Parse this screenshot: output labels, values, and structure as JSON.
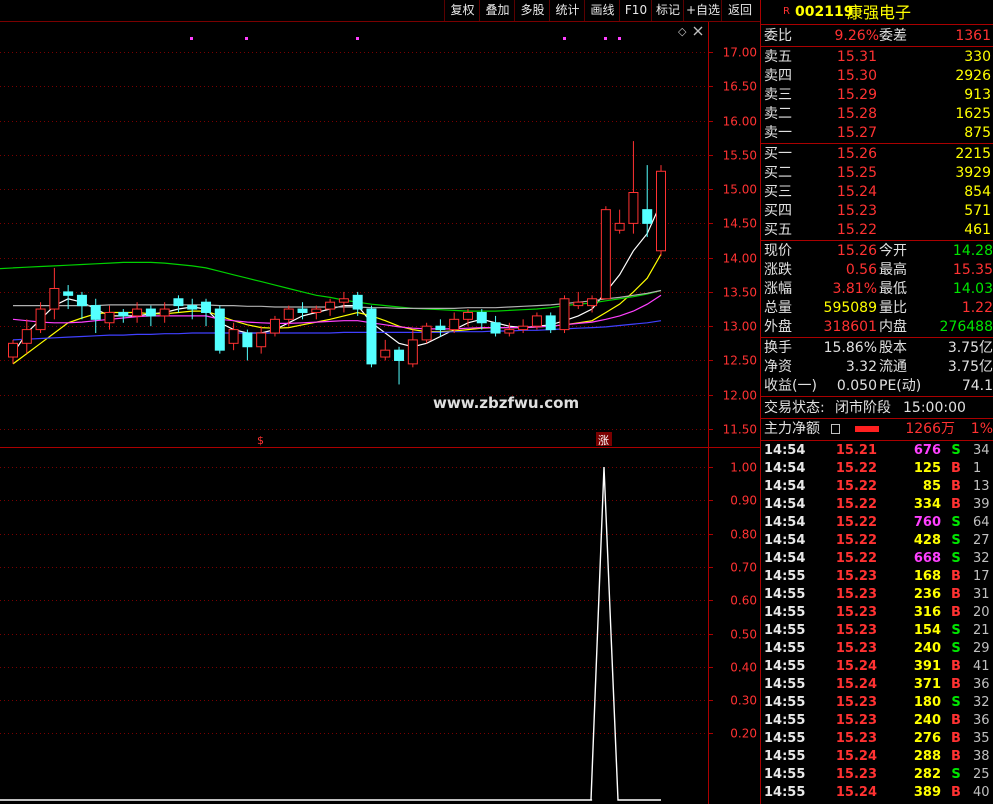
{
  "toolbar": {
    "buttons": [
      "复权",
      "叠加",
      "多股",
      "统计",
      "画线",
      "F10",
      "标记",
      "+自选",
      "返回"
    ]
  },
  "stock": {
    "badge": "R",
    "code": "002119",
    "name": "康强电子"
  },
  "price_axis": [
    "17.00",
    "16.50",
    "16.00",
    "15.50",
    "15.00",
    "14.50",
    "14.00",
    "13.50",
    "13.00",
    "12.50",
    "12.00",
    "11.50"
  ],
  "indicator_axis": [
    "1.00",
    "0.90",
    "0.80",
    "0.70",
    "0.60",
    "0.50",
    "0.40",
    "0.30",
    "0.20"
  ],
  "watermark": "www.zbzfwu.com",
  "markers": {
    "s_label": "$",
    "zhang_label": "涨",
    "diamond": "◇"
  },
  "order_book": {
    "weibi_label": "委比",
    "weibi_value": "9.26%",
    "weicha_label": "委差",
    "weicha_value": "1361",
    "asks": [
      {
        "label": "卖五",
        "price": "15.31",
        "vol": "330"
      },
      {
        "label": "卖四",
        "price": "15.30",
        "vol": "2926"
      },
      {
        "label": "卖三",
        "price": "15.29",
        "vol": "913"
      },
      {
        "label": "卖二",
        "price": "15.28",
        "vol": "1625"
      },
      {
        "label": "卖一",
        "price": "15.27",
        "vol": "875"
      }
    ],
    "bids": [
      {
        "label": "买一",
        "price": "15.26",
        "vol": "2215"
      },
      {
        "label": "买二",
        "price": "15.25",
        "vol": "3929"
      },
      {
        "label": "买三",
        "price": "15.24",
        "vol": "854"
      },
      {
        "label": "买四",
        "price": "15.23",
        "vol": "571"
      },
      {
        "label": "买五",
        "price": "15.22",
        "vol": "461"
      }
    ]
  },
  "quote": [
    {
      "l1": "现价",
      "v1": "15.26",
      "l2": "今开",
      "v2": "14.28",
      "c1": "red",
      "c2": "green"
    },
    {
      "l1": "涨跌",
      "v1": "0.56",
      "l2": "最高",
      "v2": "15.35",
      "c1": "red",
      "c2": "red"
    },
    {
      "l1": "涨幅",
      "v1": "3.81%",
      "l2": "最低",
      "v2": "14.03",
      "c1": "red",
      "c2": "green"
    },
    {
      "l1": "总量",
      "v1": "595089",
      "l2": "量比",
      "v2": "1.22",
      "c1": "yellow",
      "c2": "red"
    },
    {
      "l1": "外盘",
      "v1": "318601",
      "l2": "内盘",
      "v2": "276488",
      "c1": "red",
      "c2": "green"
    }
  ],
  "fundamentals": [
    {
      "l1": "换手",
      "v1": "15.86%",
      "l2": "股本",
      "v2": "3.75亿"
    },
    {
      "l1": "净资",
      "v1": "3.32",
      "l2": "流通",
      "v2": "3.75亿"
    },
    {
      "l1": "收益(一)",
      "v1": "0.050",
      "l2": "PE(动)",
      "v2": "74.1"
    }
  ],
  "trade_status": {
    "label": "交易状态:",
    "value": "闭市阶段",
    "time": "15:00:00"
  },
  "capital_flow": {
    "label": "主力净额",
    "value": "1266万",
    "pct": "1%"
  },
  "ticks": [
    {
      "time": "14:54",
      "price": "15.21",
      "vol": "676",
      "bs": "S",
      "n": "34",
      "vc": "magenta"
    },
    {
      "time": "14:54",
      "price": "15.22",
      "vol": "125",
      "bs": "B",
      "n": "1",
      "vc": "yellow"
    },
    {
      "time": "14:54",
      "price": "15.22",
      "vol": "85",
      "bs": "B",
      "n": "13",
      "vc": "yellow"
    },
    {
      "time": "14:54",
      "price": "15.22",
      "vol": "334",
      "bs": "B",
      "n": "39",
      "vc": "yellow"
    },
    {
      "time": "14:54",
      "price": "15.22",
      "vol": "760",
      "bs": "S",
      "n": "64",
      "vc": "magenta"
    },
    {
      "time": "14:54",
      "price": "15.22",
      "vol": "428",
      "bs": "S",
      "n": "27",
      "vc": "yellow"
    },
    {
      "time": "14:54",
      "price": "15.22",
      "vol": "668",
      "bs": "S",
      "n": "32",
      "vc": "magenta"
    },
    {
      "time": "14:55",
      "price": "15.23",
      "vol": "168",
      "bs": "B",
      "n": "17",
      "vc": "yellow"
    },
    {
      "time": "14:55",
      "price": "15.23",
      "vol": "236",
      "bs": "B",
      "n": "31",
      "vc": "yellow"
    },
    {
      "time": "14:55",
      "price": "15.23",
      "vol": "316",
      "bs": "B",
      "n": "20",
      "vc": "yellow"
    },
    {
      "time": "14:55",
      "price": "15.23",
      "vol": "154",
      "bs": "S",
      "n": "21",
      "vc": "yellow"
    },
    {
      "time": "14:55",
      "price": "15.23",
      "vol": "240",
      "bs": "S",
      "n": "29",
      "vc": "yellow"
    },
    {
      "time": "14:55",
      "price": "15.24",
      "vol": "391",
      "bs": "B",
      "n": "41",
      "vc": "yellow"
    },
    {
      "time": "14:55",
      "price": "15.24",
      "vol": "371",
      "bs": "B",
      "n": "36",
      "vc": "yellow"
    },
    {
      "time": "14:55",
      "price": "15.23",
      "vol": "180",
      "bs": "S",
      "n": "32",
      "vc": "yellow"
    },
    {
      "time": "14:55",
      "price": "15.23",
      "vol": "240",
      "bs": "B",
      "n": "36",
      "vc": "yellow"
    },
    {
      "time": "14:55",
      "price": "15.23",
      "vol": "276",
      "bs": "B",
      "n": "35",
      "vc": "yellow"
    },
    {
      "time": "14:55",
      "price": "15.24",
      "vol": "288",
      "bs": "B",
      "n": "38",
      "vc": "yellow"
    },
    {
      "time": "14:55",
      "price": "15.23",
      "vol": "282",
      "bs": "S",
      "n": "25",
      "vc": "yellow"
    },
    {
      "time": "14:55",
      "price": "15.24",
      "vol": "389",
      "bs": "B",
      "n": "40",
      "vc": "yellow"
    }
  ],
  "colors": {
    "up": "#ff3232",
    "down": "#54ffff",
    "grid": "#7a0000",
    "yellow": "#ffff00",
    "green": "#00e600",
    "magenta": "#ff40ff"
  },
  "chart_data": [
    {
      "type": "candlestick",
      "yaxis": "price",
      "ylim": [
        11.3,
        17.4
      ],
      "candles": [
        [
          12.55,
          12.75,
          12.45,
          12.8
        ],
        [
          12.75,
          12.95,
          12.6,
          13.1
        ],
        [
          12.95,
          13.25,
          12.9,
          13.35
        ],
        [
          13.25,
          13.55,
          13.1,
          13.85
        ],
        [
          13.5,
          13.45,
          13.25,
          13.6
        ],
        [
          13.45,
          13.3,
          13.1,
          13.5
        ],
        [
          13.3,
          13.1,
          12.9,
          13.4
        ],
        [
          13.05,
          13.2,
          12.95,
          13.3
        ],
        [
          13.2,
          13.15,
          13.05,
          13.25
        ],
        [
          13.15,
          13.25,
          13.05,
          13.35
        ],
        [
          13.25,
          13.15,
          13.0,
          13.3
        ],
        [
          13.15,
          13.25,
          13.05,
          13.35
        ],
        [
          13.4,
          13.3,
          13.2,
          13.45
        ],
        [
          13.3,
          13.25,
          13.1,
          13.4
        ],
        [
          13.35,
          13.2,
          13.0,
          13.4
        ],
        [
          13.25,
          12.65,
          12.6,
          13.3
        ],
        [
          12.75,
          12.95,
          12.65,
          13.05
        ],
        [
          12.9,
          12.7,
          12.5,
          12.95
        ],
        [
          12.7,
          12.9,
          12.6,
          13.0
        ],
        [
          12.9,
          13.1,
          12.85,
          13.15
        ],
        [
          13.1,
          13.25,
          13.0,
          13.3
        ],
        [
          13.25,
          13.2,
          13.1,
          13.35
        ],
        [
          13.2,
          13.25,
          13.1,
          13.3
        ],
        [
          13.25,
          13.35,
          13.15,
          13.4
        ],
        [
          13.35,
          13.4,
          13.2,
          13.5
        ],
        [
          13.45,
          13.25,
          13.15,
          13.5
        ],
        [
          13.25,
          12.45,
          12.4,
          13.3
        ],
        [
          12.55,
          12.65,
          12.5,
          12.8
        ],
        [
          12.65,
          12.5,
          12.15,
          12.7
        ],
        [
          12.45,
          12.8,
          12.4,
          12.95
        ],
        [
          12.8,
          13.0,
          12.75,
          13.05
        ],
        [
          13.0,
          12.95,
          12.85,
          13.1
        ],
        [
          12.95,
          13.1,
          12.9,
          13.2
        ],
        [
          13.1,
          13.2,
          13.0,
          13.25
        ],
        [
          13.2,
          13.05,
          12.95,
          13.25
        ],
        [
          13.05,
          12.9,
          12.85,
          13.15
        ],
        [
          12.9,
          12.95,
          12.85,
          13.05
        ],
        [
          12.95,
          13.0,
          12.9,
          13.1
        ],
        [
          13.0,
          13.15,
          12.95,
          13.2
        ],
        [
          13.15,
          12.95,
          12.9,
          13.2
        ],
        [
          12.95,
          13.4,
          12.9,
          13.45
        ],
        [
          13.3,
          13.35,
          13.25,
          13.5
        ],
        [
          13.3,
          13.4,
          13.2,
          13.45
        ],
        [
          13.4,
          14.7,
          13.4,
          14.75
        ],
        [
          14.4,
          14.5,
          14.35,
          14.7
        ],
        [
          14.5,
          14.95,
          14.35,
          15.7
        ],
        [
          14.7,
          14.5,
          14.3,
          15.35
        ],
        [
          14.1,
          15.26,
          14.03,
          15.35
        ]
      ],
      "ma_lines": [
        {
          "name": "ma_white",
          "color": "#ffffff",
          "values": [
            12.6,
            12.9,
            13.1,
            13.3,
            13.4,
            13.35,
            13.25,
            13.15,
            13.15,
            13.15,
            13.18,
            13.2,
            13.25,
            13.28,
            13.25,
            13.05,
            12.95,
            12.9,
            12.9,
            12.95,
            13.05,
            13.15,
            13.2,
            13.25,
            13.3,
            13.3,
            13.05,
            12.9,
            12.75,
            12.7,
            12.75,
            12.85,
            12.95,
            13.05,
            13.1,
            13.05,
            13.0,
            12.98,
            13.0,
            13.02,
            13.08,
            13.15,
            13.25,
            13.5,
            13.75,
            14.1,
            14.35,
            14.8
          ]
        },
        {
          "name": "ma_yellow",
          "color": "#ffff00",
          "values": [
            12.45,
            12.6,
            12.75,
            12.9,
            13.05,
            13.12,
            13.18,
            13.2,
            13.2,
            13.2,
            13.18,
            13.18,
            13.2,
            13.22,
            13.22,
            13.15,
            13.08,
            13.02,
            12.98,
            12.97,
            12.98,
            13.02,
            13.06,
            13.1,
            13.15,
            13.2,
            13.15,
            13.08,
            13.0,
            12.95,
            12.92,
            12.92,
            12.93,
            12.95,
            12.97,
            12.98,
            12.98,
            12.98,
            12.99,
            13.0,
            13.02,
            13.05,
            13.08,
            13.2,
            13.32,
            13.5,
            13.7,
            14.05
          ]
        },
        {
          "name": "ma_magenta",
          "color": "#ff40ff",
          "values": [
            13.1,
            13.08,
            13.06,
            13.05,
            13.05,
            13.06,
            13.08,
            13.1,
            13.12,
            13.14,
            13.15,
            13.15,
            13.15,
            13.15,
            13.15,
            13.1,
            13.08,
            13.06,
            13.05,
            13.04,
            13.04,
            13.05,
            13.06,
            13.07,
            13.08,
            13.08,
            13.05,
            13.02,
            12.99,
            12.97,
            12.96,
            12.96,
            12.96,
            12.97,
            12.98,
            12.98,
            12.98,
            12.98,
            12.99,
            13.0,
            13.02,
            13.04,
            13.06,
            13.1,
            13.15,
            13.22,
            13.32,
            13.45
          ]
        },
        {
          "name": "ma_green",
          "color": "#00d000",
          "values": [
            13.85,
            13.86,
            13.87,
            13.88,
            13.89,
            13.9,
            13.91,
            13.92,
            13.93,
            13.93,
            13.93,
            13.92,
            13.9,
            13.88,
            13.85,
            13.8,
            13.75,
            13.7,
            13.65,
            13.6,
            13.55,
            13.5,
            13.45,
            13.42,
            13.38,
            13.35,
            13.32,
            13.3,
            13.28,
            13.26,
            13.25,
            13.24,
            13.23,
            13.22,
            13.22,
            13.22,
            13.23,
            13.24,
            13.25,
            13.27,
            13.3,
            13.32,
            13.34,
            13.37,
            13.4,
            13.43,
            13.47,
            13.52
          ]
        },
        {
          "name": "ma_gray",
          "color": "#b0b0b0",
          "values": [
            13.3,
            13.3,
            13.3,
            13.3,
            13.3,
            13.3,
            13.3,
            13.31,
            13.31,
            13.31,
            13.31,
            13.31,
            13.31,
            13.31,
            13.31,
            13.3,
            13.3,
            13.29,
            13.29,
            13.28,
            13.28,
            13.28,
            13.28,
            13.28,
            13.28,
            13.28,
            13.27,
            13.27,
            13.26,
            13.26,
            13.26,
            13.26,
            13.26,
            13.27,
            13.27,
            13.27,
            13.28,
            13.29,
            13.3,
            13.31,
            13.33,
            13.35,
            13.37,
            13.4,
            13.42,
            13.45,
            13.48,
            13.52
          ]
        },
        {
          "name": "ma_blue",
          "color": "#4040ff",
          "values": [
            12.8,
            12.81,
            12.82,
            12.83,
            12.84,
            12.85,
            12.86,
            12.87,
            12.87,
            12.88,
            12.88,
            12.89,
            12.89,
            12.9,
            12.9,
            12.9,
            12.9,
            12.9,
            12.9,
            12.9,
            12.9,
            12.9,
            12.9,
            12.9,
            12.91,
            12.91,
            12.91,
            12.91,
            12.91,
            12.91,
            12.91,
            12.91,
            12.92,
            12.92,
            12.92,
            12.93,
            12.93,
            12.94,
            12.94,
            12.95,
            12.96,
            12.97,
            12.98,
            12.99,
            13.01,
            13.03,
            13.05,
            13.08
          ]
        }
      ]
    },
    {
      "type": "line",
      "yaxis": "indicator",
      "ylim": [
        0,
        1.05
      ],
      "values": [
        0,
        0,
        0,
        0,
        0,
        0,
        0,
        0,
        0,
        0,
        0,
        0,
        0,
        0,
        0,
        0,
        0,
        0,
        0,
        0,
        0,
        0,
        0,
        0,
        0,
        0,
        0,
        0,
        0,
        0,
        0,
        0,
        0,
        0,
        0,
        0,
        0,
        0,
        0,
        0,
        0,
        0,
        0,
        0,
        1,
        0,
        0,
        0
      ]
    }
  ]
}
